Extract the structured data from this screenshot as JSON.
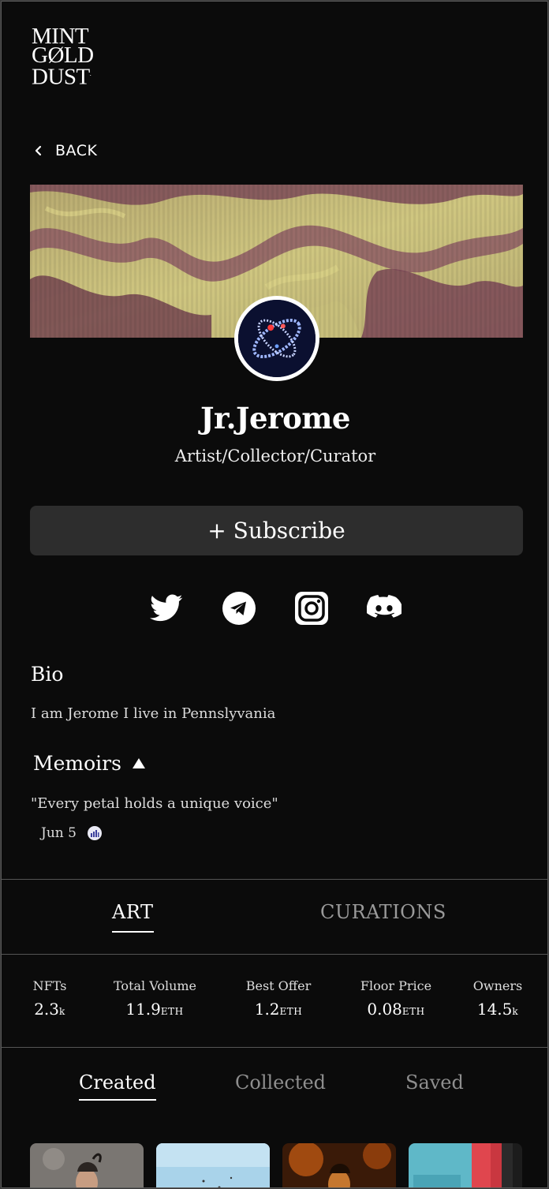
{
  "logo": {
    "line1": "MINT",
    "line2": "GØLD",
    "line3": "DUST",
    "reg": "."
  },
  "nav": {
    "back_label": "BACK"
  },
  "profile": {
    "name": "Jr.Jerome",
    "role": "Artist/Collector/Curator",
    "subscribe_label": "+ Subscribe"
  },
  "socials": [
    "twitter-icon",
    "telegram-icon",
    "instagram-icon",
    "discord-icon"
  ],
  "bio": {
    "heading": "Bio",
    "text": "I am Jerome I live in Pennslyvania"
  },
  "memoirs": {
    "heading": "Memoirs",
    "quote": "\"Every petal holds a unique voice\"",
    "date": "Jun 5"
  },
  "tabs": {
    "art": "ART",
    "curations": "CURATIONS"
  },
  "stats": [
    {
      "label": "NFTs",
      "value": "2.3",
      "unit": "k"
    },
    {
      "label": "Total Volume",
      "value": "11.9",
      "unit": "ETH"
    },
    {
      "label": "Best Offer",
      "value": "1.2",
      "unit": "ETH"
    },
    {
      "label": "Floor Price",
      "value": "0.08",
      "unit": "ETH"
    },
    {
      "label": "Owners",
      "value": "14.5",
      "unit": "k"
    }
  ],
  "subtabs": {
    "created": "Created",
    "collected": "Collected",
    "saved": "Saved"
  },
  "colors": {
    "background": "#0b0b0b",
    "button": "#2d2d2d",
    "banner_light": "#c8c27a",
    "banner_dark": "#7e4a5a"
  }
}
